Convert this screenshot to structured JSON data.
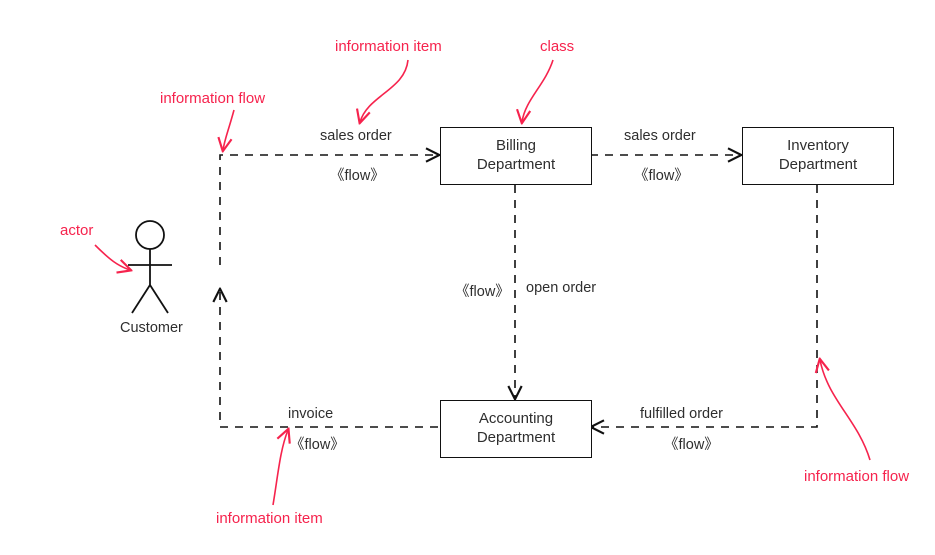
{
  "actor": {
    "name": "Customer"
  },
  "classes": {
    "billing": {
      "label": "Billing\nDepartment"
    },
    "inventory": {
      "label": "Inventory\nDepartment"
    },
    "accounting": {
      "label": "Accounting\nDepartment"
    }
  },
  "flows": {
    "customer_to_billing": {
      "item": "sales order",
      "stereotype": "《flow》"
    },
    "billing_to_inventory": {
      "item": "sales order",
      "stereotype": "《flow》"
    },
    "billing_to_accounting": {
      "item": "open order",
      "stereotype": "《flow》"
    },
    "inventory_to_accounting": {
      "item": "fulfilled order",
      "stereotype": "《flow》"
    },
    "accounting_to_customer": {
      "item": "invoice",
      "stereotype": "《flow》"
    }
  },
  "annotations": {
    "actor": "actor",
    "information_flow_1": "information flow",
    "information_item_1": "information item",
    "class": "class",
    "information_item_2": "information item",
    "information_flow_2": "information flow"
  }
}
